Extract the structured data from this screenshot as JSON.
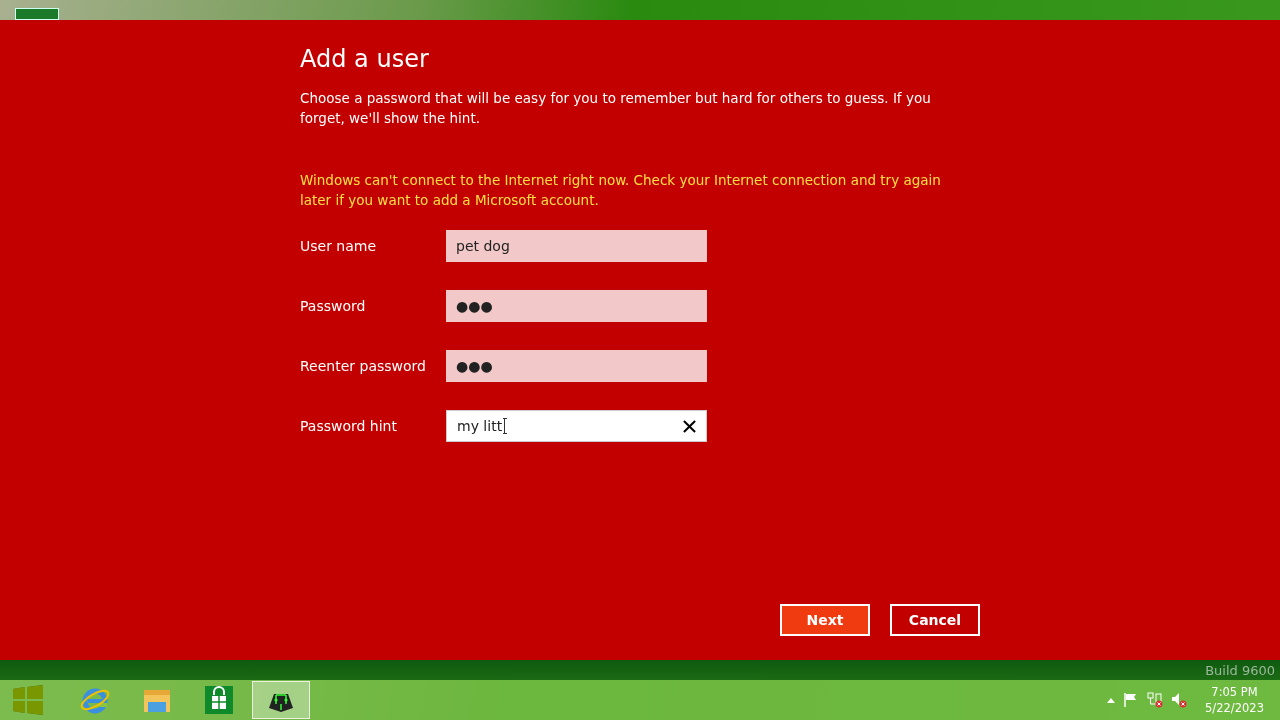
{
  "dialog": {
    "title": "Add a user",
    "description": "Choose a password that will be easy for you to remember but hard for others to guess. If you forget, we'll show the hint.",
    "warning": "Windows can't connect to the Internet right now. Check your Internet connection and try again later if you want to add a Microsoft account.",
    "fields": [
      {
        "label": "User name",
        "value": "pet dog",
        "focused": false
      },
      {
        "label": "Password",
        "value": "●●●",
        "focused": false
      },
      {
        "label": "Reenter password",
        "value": "●●●",
        "focused": false
      },
      {
        "label": "Password hint",
        "value": "my litt",
        "focused": true
      }
    ],
    "buttons": [
      {
        "label": "Next",
        "primary": true
      },
      {
        "label": "Cancel",
        "primary": false
      }
    ]
  },
  "desktop": {
    "watermark": "Build 9600"
  },
  "taskbar": {
    "apps": [
      {
        "kind": "ie",
        "selected": false
      },
      {
        "kind": "explorer",
        "selected": false
      },
      {
        "kind": "store",
        "selected": false
      },
      {
        "kind": "app",
        "selected": true
      }
    ],
    "clock": {
      "time": "7:05 PM",
      "date": "5/22/2023"
    }
  }
}
